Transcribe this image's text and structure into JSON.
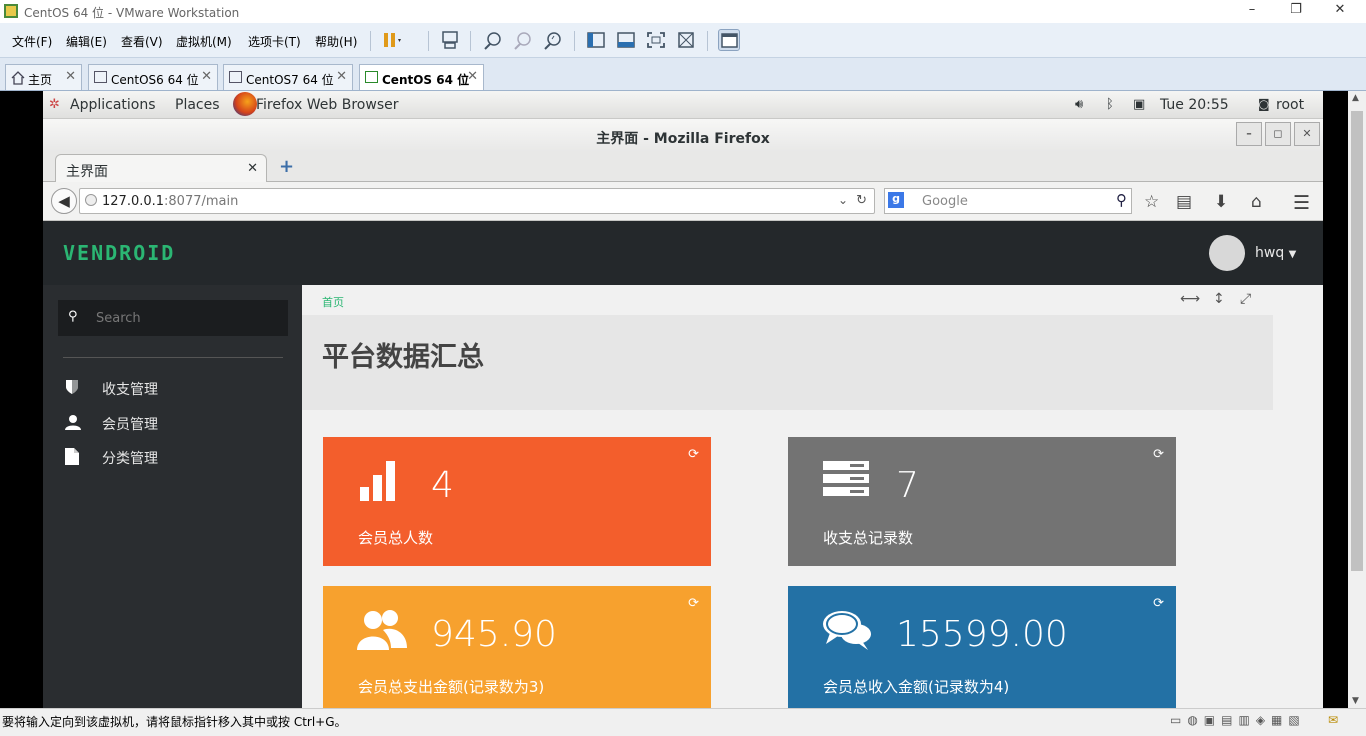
{
  "vmware": {
    "title": "CentOS 64 位 - VMware Workstation",
    "window_buttons": [
      "–",
      "❐",
      "✕"
    ],
    "menu": [
      "文件(F)",
      "编辑(E)",
      "查看(V)",
      "虚拟机(M)",
      "选项卡(T)",
      "帮助(H)"
    ],
    "tabs": [
      {
        "label": "主页"
      },
      {
        "label": "CentOS6 64 位"
      },
      {
        "label": "CentOS7 64 位"
      },
      {
        "label": "CentOS 64 位"
      }
    ],
    "status_message": "要将输入定向到该虚拟机，请将鼠标指针移入其中或按 Ctrl+G。"
  },
  "gnome": {
    "applications": "Applications",
    "places": "Places",
    "firefox": "Firefox Web Browser",
    "clock": "Tue 20:55",
    "user": "root"
  },
  "firefox": {
    "window_title": "主界面 - Mozilla Firefox",
    "tab_title": "主界面",
    "url_host": "127.0.0.1",
    "url_rest": ":8077/main",
    "search_placeholder": "Google"
  },
  "app": {
    "logo": "VENDROID",
    "username": "hwq",
    "search_placeholder": "Search",
    "sidebar": [
      {
        "label": "收支管理",
        "icon": "shield-icon"
      },
      {
        "label": "会员管理",
        "icon": "user-icon"
      },
      {
        "label": "分类管理",
        "icon": "file-icon"
      }
    ],
    "breadcrumb": "首页",
    "page_title": "平台数据汇总",
    "cards": [
      {
        "value": "4",
        "label": "会员总人数",
        "color": "#f35e2c",
        "icon": "bar-chart-icon"
      },
      {
        "value": "7",
        "label": "收支总记录数",
        "color": "#737373",
        "icon": "server-icon"
      },
      {
        "value": "945.90",
        "label": "会员总支出金额(记录数为3)",
        "color": "#f7a12e",
        "icon": "group-icon"
      },
      {
        "value": "15599.00",
        "label": "会员总收入金额(记录数为4)",
        "color": "#2371a5",
        "icon": "comments-icon"
      }
    ]
  }
}
